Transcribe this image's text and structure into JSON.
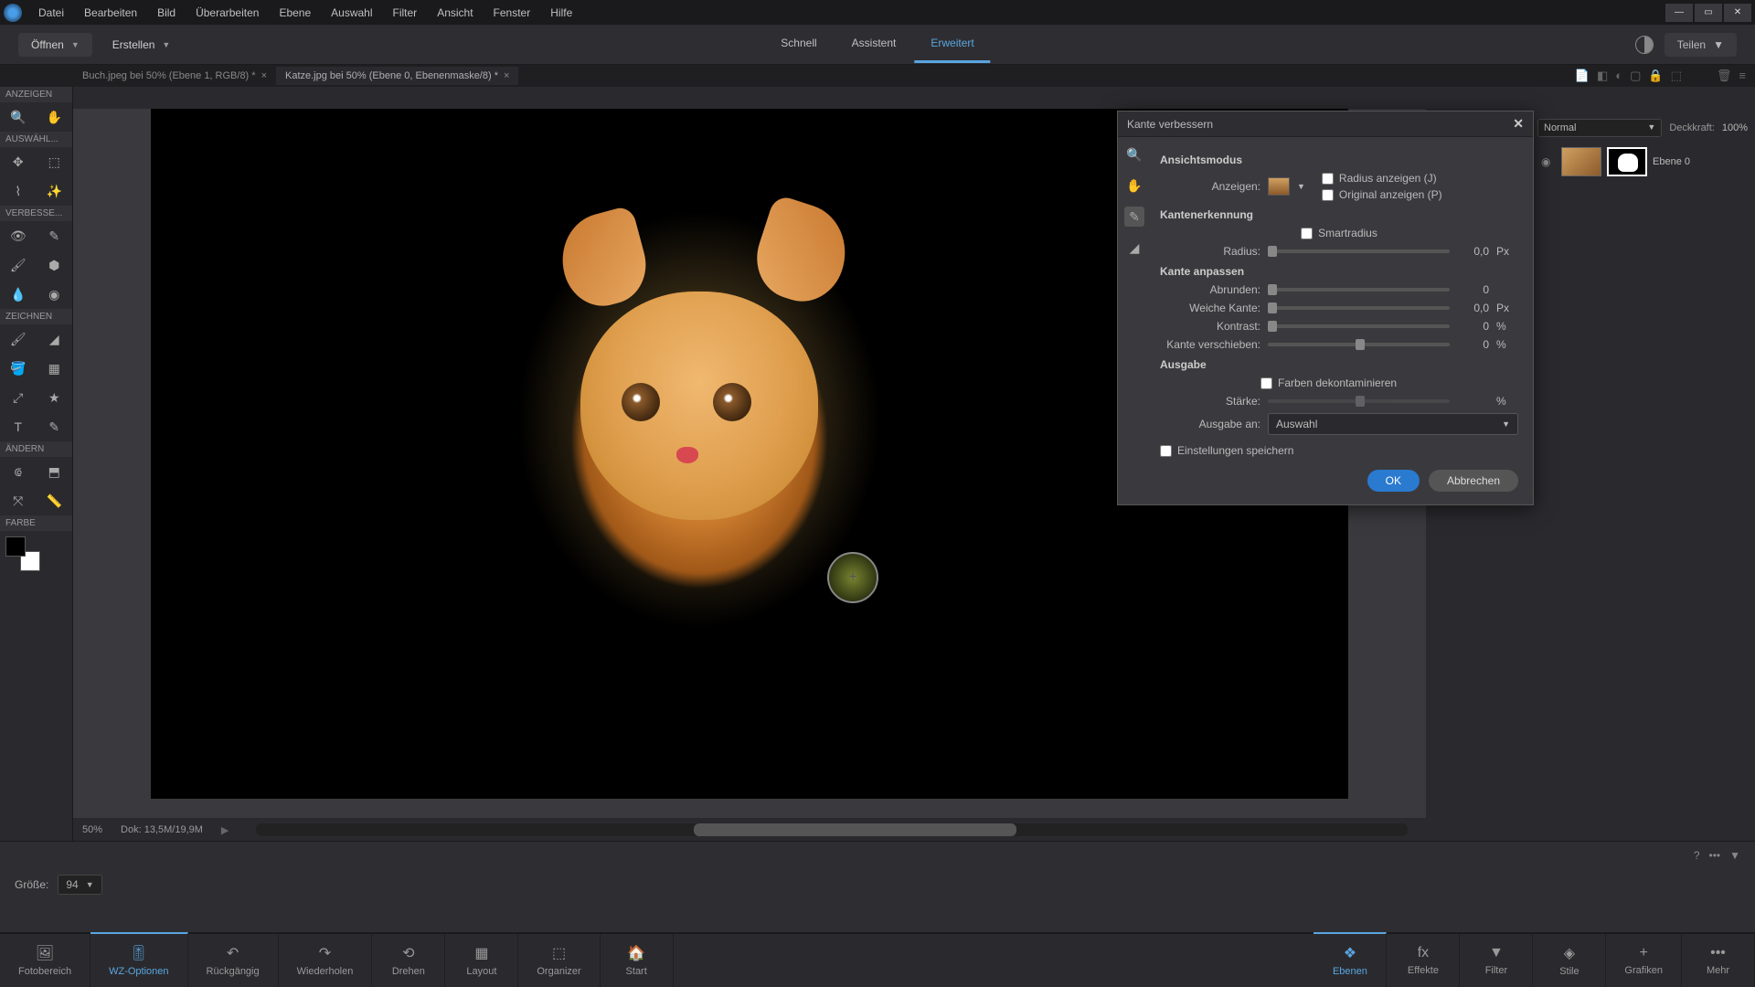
{
  "menu": [
    "Datei",
    "Bearbeiten",
    "Bild",
    "Überarbeiten",
    "Ebene",
    "Auswahl",
    "Filter",
    "Ansicht",
    "Fenster",
    "Hilfe"
  ],
  "toolbar": {
    "open": "Öffnen",
    "create": "Erstellen",
    "share": "Teilen"
  },
  "modes": {
    "quick": "Schnell",
    "guided": "Assistent",
    "expert": "Erweitert"
  },
  "doc_tabs": [
    {
      "label": "Buch.jpeg bei 50% (Ebene 1, RGB/8) *",
      "active": false
    },
    {
      "label": "Katze.jpg bei 50% (Ebene 0, Ebenenmaske/8) *",
      "active": true
    }
  ],
  "tool_sections": {
    "view": "ANZEIGEN",
    "select": "AUSWÄHL...",
    "enhance": "VERBESSE...",
    "draw": "ZEICHNEN",
    "modify": "ÄNDERN",
    "color": "FARBE"
  },
  "canvas": {
    "zoom": "50%",
    "doc_size": "Dok: 13,5M/19,9M"
  },
  "options": {
    "size_label": "Größe:",
    "size_value": "94"
  },
  "layers": {
    "blend_mode": "Normal",
    "opacity_label": "Deckkraft:",
    "opacity_value": "100%",
    "layer0_name": "Ebene 0"
  },
  "dialog": {
    "title": "Kante verbessern",
    "section_viewmode": "Ansichtsmodus",
    "view_label": "Anzeigen:",
    "show_radius": "Radius anzeigen (J)",
    "show_original": "Original anzeigen (P)",
    "section_edge": "Kantenerkennung",
    "smart_radius": "Smartradius",
    "radius_label": "Radius:",
    "radius_value": "0,0",
    "section_adjust": "Kante anpassen",
    "smooth_label": "Abrunden:",
    "smooth_value": "0",
    "feather_label": "Weiche Kante:",
    "feather_value": "0,0",
    "contrast_label": "Kontrast:",
    "contrast_value": "0",
    "shift_label": "Kante verschieben:",
    "shift_value": "0",
    "section_output": "Ausgabe",
    "decontaminate": "Farben dekontaminieren",
    "amount_label": "Stärke:",
    "output_to_label": "Ausgabe an:",
    "output_to_value": "Auswahl",
    "remember": "Einstellungen speichern",
    "ok": "OK",
    "cancel": "Abbrechen",
    "unit_px": "Px",
    "unit_pct": "%"
  },
  "bottom": {
    "photo_bin": "Fotobereich",
    "tool_options": "WZ-Optionen",
    "undo": "Rückgängig",
    "redo": "Wiederholen",
    "rotate": "Drehen",
    "layout": "Layout",
    "organizer": "Organizer",
    "home": "Start",
    "layers": "Ebenen",
    "effects": "Effekte",
    "filters": "Filter",
    "styles": "Stile",
    "graphics": "Grafiken",
    "more": "Mehr"
  }
}
